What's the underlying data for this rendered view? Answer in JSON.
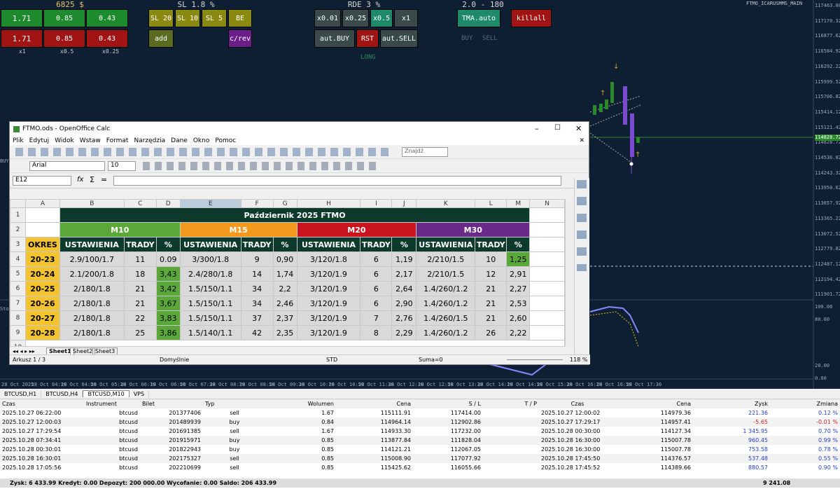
{
  "mt": {
    "headers": [
      "6825 $",
      "SL 1.8 %",
      "RDE 3 %",
      "2.0 - 180"
    ],
    "lot_buttons": {
      "row1": [
        "1.71",
        "0.85",
        "0.43"
      ],
      "row2": [
        "1.71",
        "0.85",
        "0.43"
      ],
      "sub": [
        "x1",
        "x0.5",
        "x0.25"
      ]
    },
    "sl_buttons": [
      "SL 20",
      "SL 10",
      "SL 5",
      "BE"
    ],
    "add_label": "add",
    "crev_label": "c/rev",
    "mult_buttons": [
      "x0.01",
      "x0.25",
      "x0.5",
      "x1"
    ],
    "aut_buy": "aut.BUY",
    "rst": "RST",
    "aut_sell": "aut.SELL",
    "long": "LONG",
    "tma": "TMA.auto",
    "killall": "killall",
    "buy": "BUY",
    "sell": "SELL",
    "symbol": "FTMO_ICARUSMMS_MAIN",
    "left_buy": "BUY",
    "left_stoch": "Stoch",
    "price_labels": [
      "117463.00",
      "117170.32",
      "116877.62",
      "116584.92",
      "116292.22",
      "115999.52",
      "115706.82",
      "115414.12",
      "115121.42",
      "114828.72",
      "114536.02",
      "114243.32",
      "113950.62",
      "113657.92",
      "113365.22",
      "113072.52",
      "112779.82",
      "112487.12",
      "112194.42",
      "111901.72"
    ],
    "current_price": "114828.72",
    "osc_labels": [
      "100.00",
      "80.00",
      "20.00",
      "0.00"
    ],
    "time_labels": [
      "28 Oct 2025",
      "28 Oct 04:10",
      "28 Oct 04:50",
      "28 Oct 05:30",
      "28 Oct 06:10",
      "28 Oct 06:50",
      "28 Oct 07:30",
      "28 Oct 08:10",
      "28 Oct 08:50",
      "28 Oct 09:30",
      "28 Oct 10:10",
      "28 Oct 10:50",
      "28 Oct 11:30",
      "28 Oct 12:10",
      "28 Oct 12:50",
      "28 Oct 13:30",
      "28 Oct 14:10",
      "28 Oct 14:50",
      "28 Oct 15:30",
      "28 Oct 16:10",
      "28 Oct 16:50",
      "28 Oct 17:30"
    ]
  },
  "calc": {
    "title": "FTMO.ods - OpenOffice Calc",
    "menu": [
      "Plik",
      "Edytuj",
      "Widok",
      "Wstaw",
      "Format",
      "Narzędzia",
      "Dane",
      "Okno",
      "Pomoc"
    ],
    "font": "Arial",
    "size": "10",
    "find": "Znajdź",
    "cell_ref": "E12",
    "cols": [
      "A",
      "B",
      "C",
      "D",
      "E",
      "F",
      "G",
      "H",
      "I",
      "J",
      "K",
      "L",
      "M",
      "N"
    ],
    "sheet_title": "Październik 2025 FTMO",
    "groups": [
      "M10",
      "M15",
      "M20",
      "M30"
    ],
    "colheads": [
      "OKRES",
      "USTAWIENIA",
      "TRADY",
      "%",
      "USTAWIENIA",
      "TRADY",
      "%",
      "USTAWIENIA",
      "TRADY",
      "%",
      "USTAWIENIA",
      "TRADY",
      "%"
    ],
    "rows": [
      [
        "20-23",
        "2.9/100/1.7",
        "11",
        "0.09",
        "3/300/1.8",
        "9",
        "0,90",
        "3/120/1.8",
        "6",
        "1,19",
        "2/210/1.5",
        "10",
        "1,25"
      ],
      [
        "20-24",
        "2.1/200/1.8",
        "18",
        "3,43",
        "2.4/280/1.8",
        "14",
        "1,74",
        "3/120/1.9",
        "6",
        "2,17",
        "2/210/1.5",
        "12",
        "2,91"
      ],
      [
        "20-25",
        "2/180/1.8",
        "21",
        "3,42",
        "1.5/150/1.1",
        "34",
        "2,2",
        "3/120/1.9",
        "6",
        "2,64",
        "1.4/260/1.2",
        "21",
        "2,27"
      ],
      [
        "20-26",
        "2/180/1.8",
        "21",
        "3,67",
        "1.5/150/1.1",
        "34",
        "2,46",
        "3/120/1.9",
        "6",
        "2,90",
        "1.4/260/1.2",
        "21",
        "2,53"
      ],
      [
        "20-27",
        "2/180/1.8",
        "22",
        "3,83",
        "1.5/150/1.1",
        "37",
        "2,37",
        "3/120/1.9",
        "7",
        "2,76",
        "1.4/260/1.5",
        "21",
        "2,60"
      ],
      [
        "20-28",
        "2/180/1.8",
        "25",
        "3,86",
        "1.5/140/1.1",
        "42",
        "2,35",
        "3/120/1.9",
        "8",
        "2,29",
        "1.4/260/1.2",
        "26",
        "2,22"
      ]
    ],
    "sheets": [
      "Sheet1",
      "Sheet2",
      "Sheet3"
    ],
    "status": {
      "sheet": "Arkusz 1 / 3",
      "style": "Domyślnie",
      "mode": "STD",
      "sum": "Suma=0",
      "zoom": "118 %"
    }
  },
  "trades": {
    "tabs": [
      "BTCUSD,H1",
      "BTCUSD,H4",
      "BTCUSD,M10",
      "VPS"
    ],
    "headers": [
      "Czas",
      "Instrument",
      "Bilet",
      "Typ",
      "Wolumen",
      "Cena",
      "S / L",
      "T / P",
      "Czas",
      "Cena",
      "Zysk",
      "Zmiana"
    ],
    "rows": [
      [
        "2025.10.27 06:22:00",
        "btcusd",
        "201377406",
        "sell",
        "1.67",
        "115111.91",
        "117414.00",
        "",
        "2025.10.27 12:00:02",
        "114979.36",
        "221.36",
        "0.12 %"
      ],
      [
        "2025.10.27 12:00:03",
        "btcusd",
        "201489939",
        "buy",
        "0.84",
        "114964.14",
        "112902.86",
        "",
        "2025.10.27 17:29:17",
        "114957.41",
        "-5.65",
        "-0.01 %"
      ],
      [
        "2025.10.27 17:29:54",
        "btcusd",
        "201691385",
        "sell",
        "1.67",
        "114933.30",
        "117232.00",
        "",
        "2025.10.28 00:30:00",
        "114127.34",
        "1 345.95",
        "0.70 %"
      ],
      [
        "2025.10.28 07:34:41",
        "btcusd",
        "201915971",
        "buy",
        "0.85",
        "113877.84",
        "111828.04",
        "",
        "2025.10.28 16:30:00",
        "115007.78",
        "960.45",
        "0.99 %"
      ],
      [
        "2025.10.28 00:30:01",
        "btcusd",
        "201822943",
        "buy",
        "0.85",
        "114121.21",
        "112067.05",
        "",
        "2025.10.28 16:30:00",
        "115007.78",
        "753.58",
        "0.78 %"
      ],
      [
        "2025.10.28 16:30:01",
        "btcusd",
        "202175327",
        "sell",
        "0.85",
        "115008.90",
        "117077.92",
        "",
        "2025.10.28 17:45:50",
        "114376.57",
        "537.48",
        "0.55 %"
      ],
      [
        "2025.10.28 17:05:56",
        "btcusd",
        "202210699",
        "sell",
        "0.85",
        "115425.62",
        "116055.66",
        "",
        "2025.10.28 17:45:52",
        "114389.66",
        "880.57",
        "0.90 %"
      ]
    ],
    "summary": "Zysk: 6 433.99  Kredyt: 0.00  Depozyt: 200 000.00  Wycofanie: 0.00  Saldo: 206 433.99",
    "total": "9 241.08"
  },
  "colors": {
    "m10": "#5aa83a",
    "m15": "#f39a1e",
    "m20": "#c8141e",
    "m30": "#6a2a8a",
    "okres": "#f3c430",
    "dark": "#0e3a2e"
  }
}
